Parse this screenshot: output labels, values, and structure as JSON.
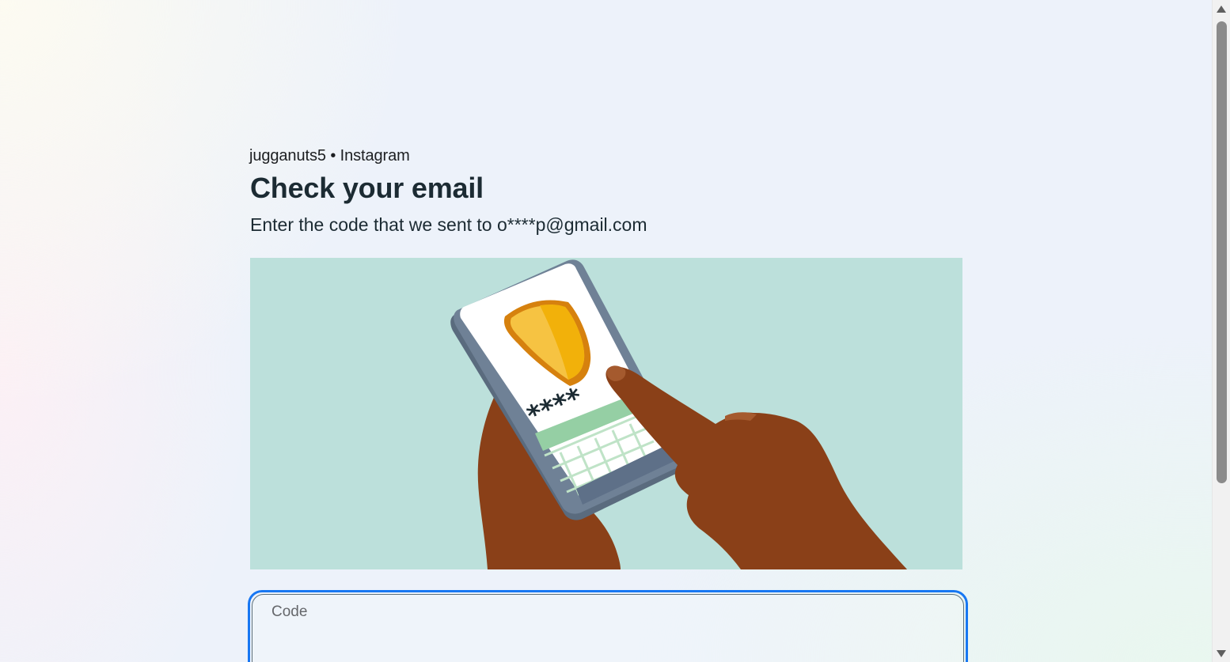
{
  "header": {
    "account_line": "jugganuts5 • Instagram",
    "title": "Check your email",
    "subtitle": "Enter the code that we sent to o****p@gmail.com"
  },
  "illustration": {
    "name": "phone-security-code-illustration",
    "masked_code": "****",
    "background_color": "#bce0db"
  },
  "code_field": {
    "label": "Code",
    "value": ""
  },
  "colors": {
    "focus_border": "#1877f2",
    "text_primary": "#1c2b33"
  }
}
